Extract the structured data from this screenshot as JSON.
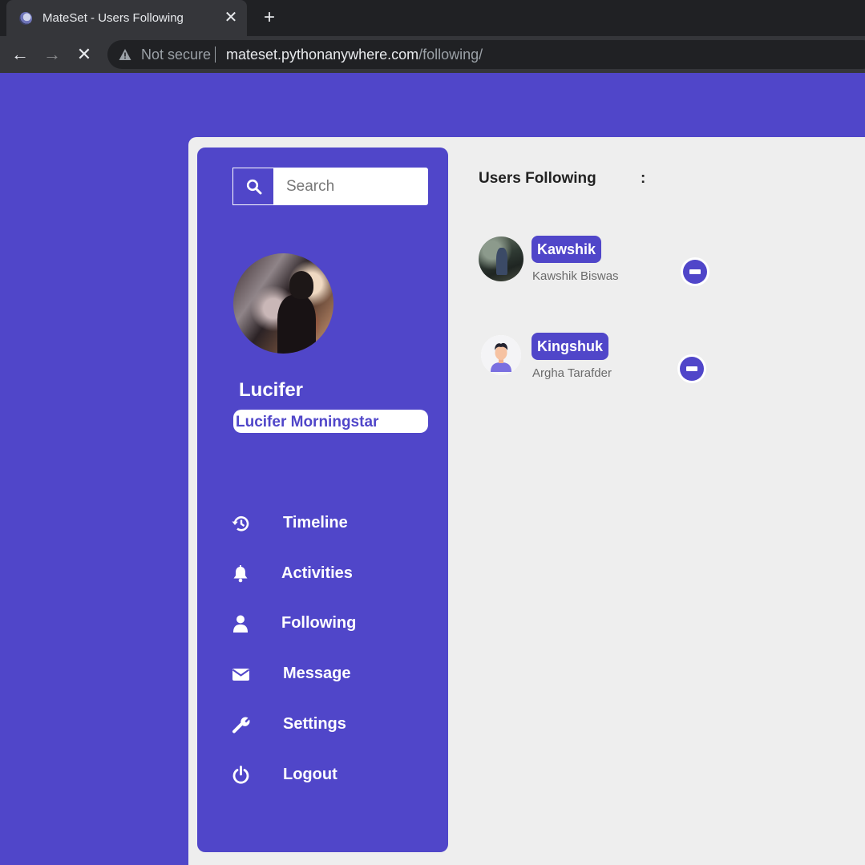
{
  "browser": {
    "tab_title": "MateSet - Users Following",
    "close_glyph": "✕",
    "new_tab_glyph": "+",
    "not_secure": "Not secure",
    "url_host": "mateset.pythonanywhere.com",
    "url_path": "/following/",
    "back_glyph": "←",
    "forward_glyph": "→",
    "stop_glyph": "✕"
  },
  "search": {
    "placeholder": "Search",
    "icon": "search-icon"
  },
  "profile": {
    "username": "Lucifer",
    "full_name": "Lucifer Morningstar"
  },
  "menu": [
    {
      "label": "Timeline",
      "icon": "history-icon"
    },
    {
      "label": "Activities",
      "icon": "bell-icon"
    },
    {
      "label": "Following",
      "icon": "user-icon"
    },
    {
      "label": "Message",
      "icon": "envelope-icon"
    },
    {
      "label": "Settings",
      "icon": "wrench-icon"
    },
    {
      "label": "Logout",
      "icon": "power-icon"
    }
  ],
  "main": {
    "heading": "Users Following",
    "heading_colon": ":",
    "users": [
      {
        "username": "Kawshik",
        "full_name": "Kawshik Biswas",
        "action_icon": "minus-circle-icon"
      },
      {
        "username": "Kingshuk",
        "full_name": "Argha Tarafder",
        "action_icon": "minus-circle-icon"
      }
    ]
  },
  "colors": {
    "accent": "#5046c9",
    "content_bg": "#eeeeee",
    "chrome_dark": "#202124",
    "chrome_mid": "#35363a"
  }
}
